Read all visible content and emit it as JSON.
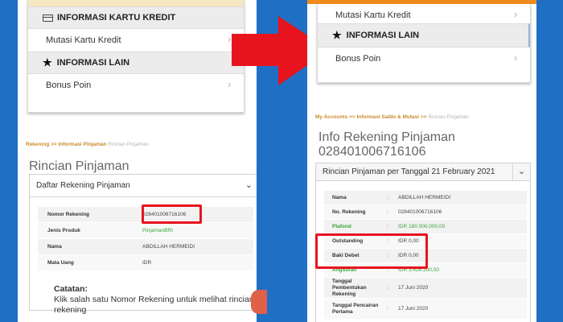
{
  "left_screen": {
    "menu": {
      "credit_card_header": "INFORMASI KARTU KREDIT",
      "credit_card_item": "Mutasi Kartu Kredit",
      "other_header": "INFORMASI LAIN",
      "bonus_item": "Bonus Poin"
    },
    "breadcrumb": {
      "link1": "Rekening",
      "sep": " >> ",
      "link2": "Informasi Pinjaman",
      "current": "Rincian Pinjaman"
    },
    "page_title": "Rincian Pinjaman",
    "panel_title": "Daftar Rekening Pinjaman",
    "rows": [
      {
        "label": "Nomor Rekening",
        "value": "028401006716106"
      },
      {
        "label": "Jenis Produk",
        "value": "PinjamanBRI"
      },
      {
        "label": "Nama",
        "value": "ABDILLAH HERMEIDI"
      },
      {
        "label": "Mata Uang",
        "value": "IDR"
      }
    ],
    "note_title": "Catatan:",
    "note_text": "Klik salah satu Nomor Rekening untuk melihat rincian rekening"
  },
  "right_screen": {
    "menu": {
      "credit_card_item": "Mutasi Kartu Kredit",
      "other_header": "INFORMASI LAIN",
      "bonus_item": "Bonus Poin"
    },
    "breadcrumb": {
      "link1": "My Accounts",
      "sep": " >> ",
      "link2": "Informasi Saldo & Mutasi",
      "current": "Rincian Pinjaman"
    },
    "page_title_line1": "Info Rekening Pinjaman",
    "page_title_line2": "028401006716106",
    "panel_title": "Rincian Pinjaman per Tanggal 21 February 2021",
    "colon": ":",
    "rows": [
      {
        "label": "Nama",
        "value": "ABDILLAH HERMEIDI"
      },
      {
        "label": "No. Rekening",
        "value": "028401006716106"
      },
      {
        "label": "Plafond",
        "value": "IDR 180.000.000,00"
      },
      {
        "label": "Outstanding",
        "value": "IDR 0,00"
      },
      {
        "label": "Baki Debet",
        "value": "IDR 0,00"
      },
      {
        "label": "Angsuran",
        "value": "IDR 3.426.200,00"
      },
      {
        "label": "Tanggal Pembentukan Rekening",
        "value": "17 Juni 2020"
      },
      {
        "label": "Tanggal Pencairan Pertama",
        "value": "17 Juni 2020"
      }
    ]
  },
  "colors": {
    "background": "#1f6fc4",
    "highlight": "#e8141d",
    "breadcrumb": "#c98a2b",
    "positive": "#3aa43a",
    "top_accent": "#f08a1c"
  },
  "icons": [
    "credit-card-icon",
    "star-icon",
    "chevron-right-icon",
    "chevron-down-icon",
    "right-arrow-icon"
  ]
}
